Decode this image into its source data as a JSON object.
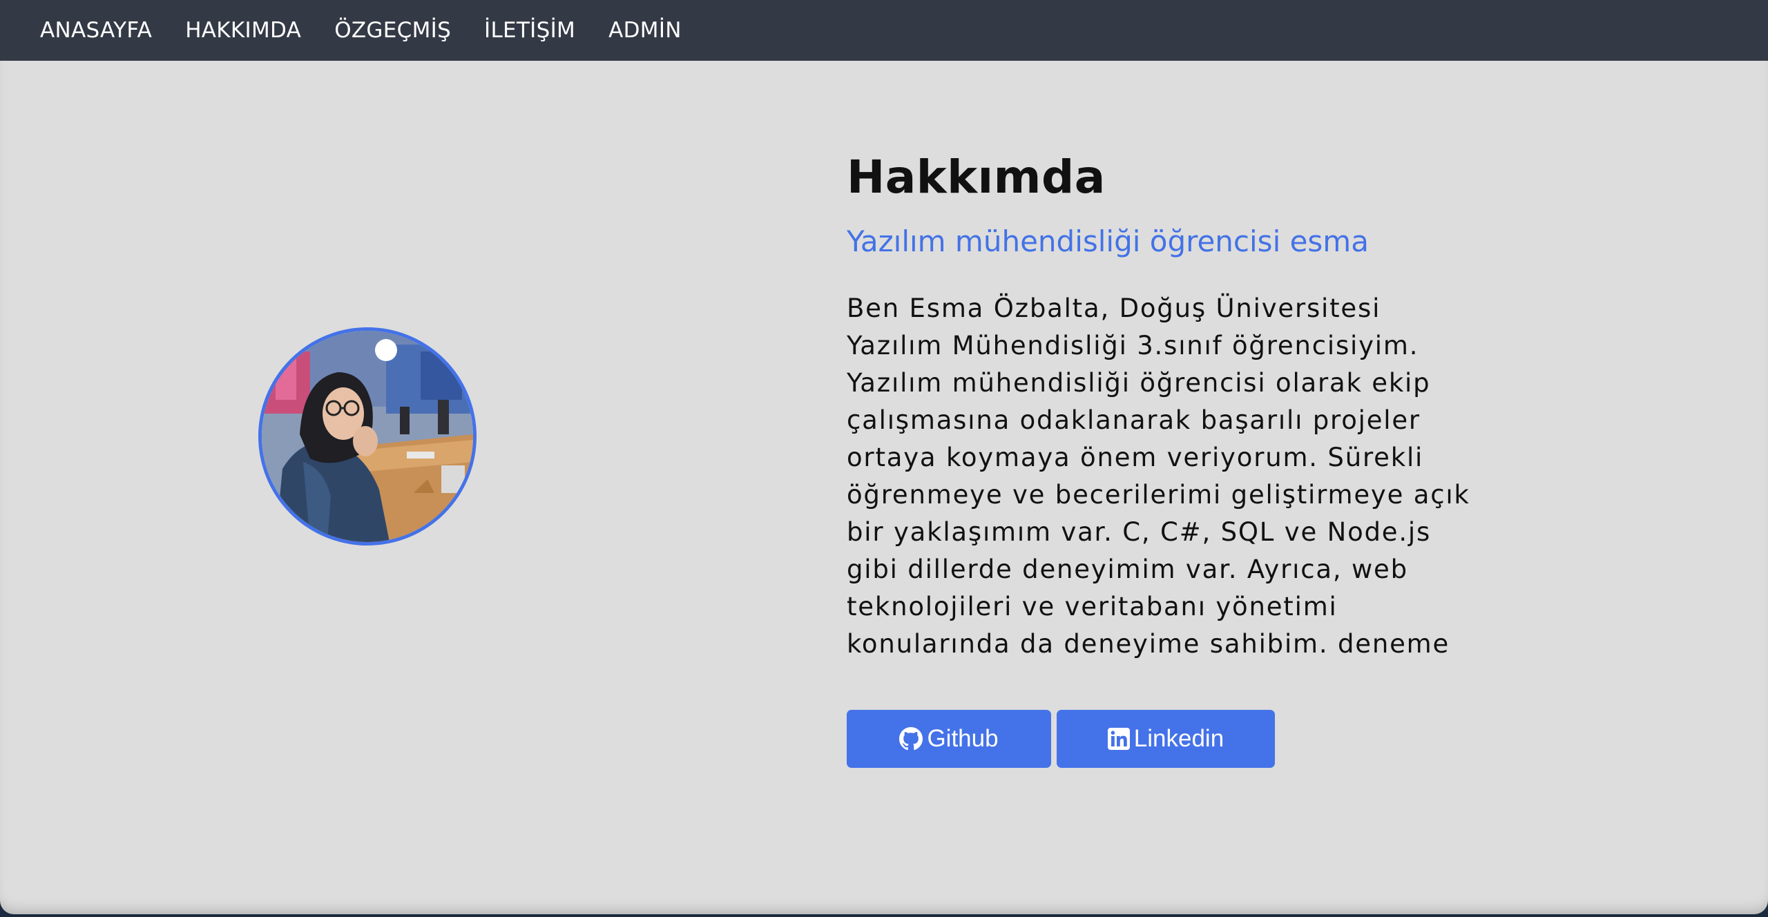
{
  "nav": {
    "items": [
      {
        "label": "ANASAYFA"
      },
      {
        "label": "HAKKIMDA"
      },
      {
        "label": "ÖZGEÇMİŞ"
      },
      {
        "label": "İLETİŞİM"
      },
      {
        "label": "ADMİN"
      }
    ]
  },
  "about": {
    "title": "Hakkımda",
    "subtitle": "Yazılım mühendisliği öğrencisi esma",
    "bio": "Ben Esma Özbalta, Doğuş Üniversitesi Yazılım Mühendisliği 3.sınıf öğrencisiyim. Yazılım mühendisliği öğrencisi olarak ekip çalışmasına odaklanarak başarılı projeler ortaya koymaya önem veriyorum. Sürekli öğrenmeye ve becerilerimi geliştirmeye açık bir yaklaşımım var. C, C#, SQL ve Node.js gibi dillerde deneyimim var. Ayrıca, web teknolojileri ve veritabanı yönetimi konularında da deneyime sahibim. deneme"
  },
  "buttons": {
    "github": {
      "label": "Github",
      "icon": "github-icon"
    },
    "linkedin": {
      "label": "Linkedin",
      "icon": "linkedin-icon"
    }
  },
  "colors": {
    "navbar": "#343a45",
    "background": "#dddddd",
    "accent": "#4472e8"
  }
}
